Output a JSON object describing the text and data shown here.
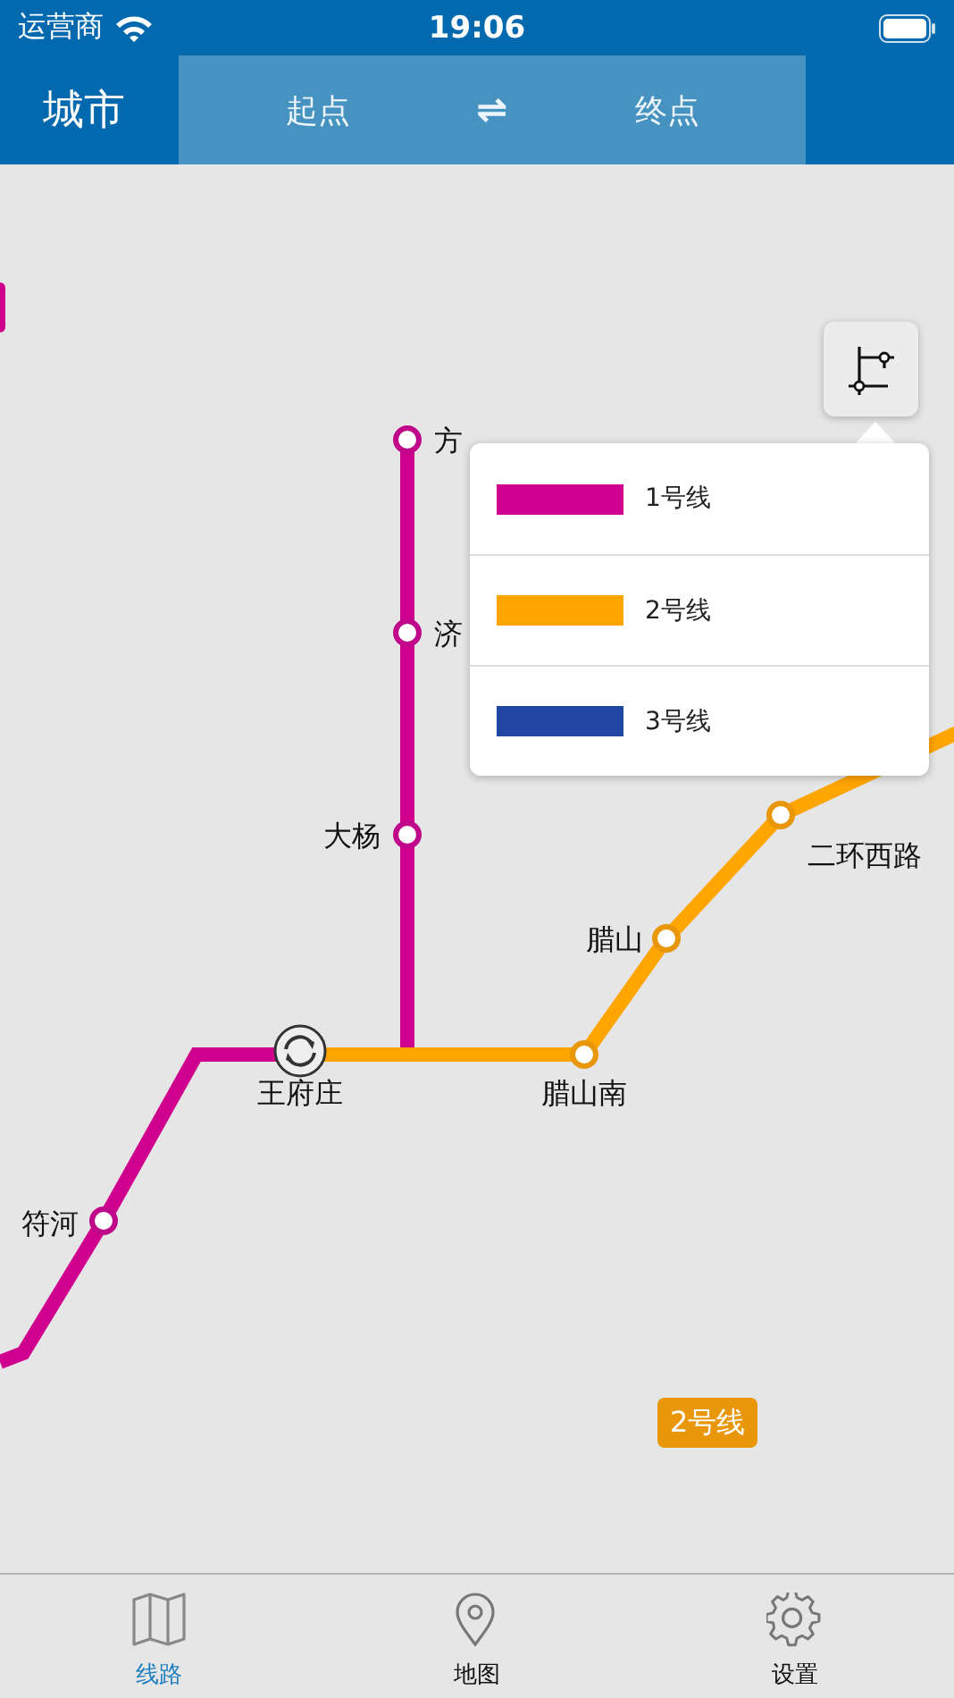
{
  "status_bar": {
    "carrier": "运营商",
    "time": "19:06"
  },
  "header": {
    "city": "城市",
    "from": "起点",
    "swap": "⇌",
    "to": "终点"
  },
  "map": {
    "stations": [
      {
        "name": "方",
        "kind": "station",
        "color": "#c0088a"
      },
      {
        "name": "济",
        "kind": "station",
        "color": "#c0088a"
      },
      {
        "name": "大杨",
        "kind": "station",
        "color": "#c0088a"
      },
      {
        "name": "王府庄",
        "kind": "transfer",
        "color": "#333333"
      },
      {
        "name": "腊山南",
        "kind": "station",
        "color": "#e8960a"
      },
      {
        "name": "腊山",
        "kind": "station",
        "color": "#e8960a"
      },
      {
        "name": "二环西路",
        "kind": "station",
        "color": "#e8960a"
      },
      {
        "name": "符河",
        "kind": "station",
        "color": "#c0088a"
      }
    ],
    "line_badge": {
      "label": "2号线",
      "color": "#e8960a"
    }
  },
  "legend": {
    "items": [
      {
        "label": "1号线",
        "color": "#d0008f"
      },
      {
        "label": "2号线",
        "color": "#ffa500"
      },
      {
        "label": "3号线",
        "color": "#2046a4"
      }
    ]
  },
  "tab_bar": [
    {
      "label": "线路",
      "selected": true
    },
    {
      "label": "地图",
      "selected": false
    },
    {
      "label": "设置",
      "selected": false
    }
  ]
}
